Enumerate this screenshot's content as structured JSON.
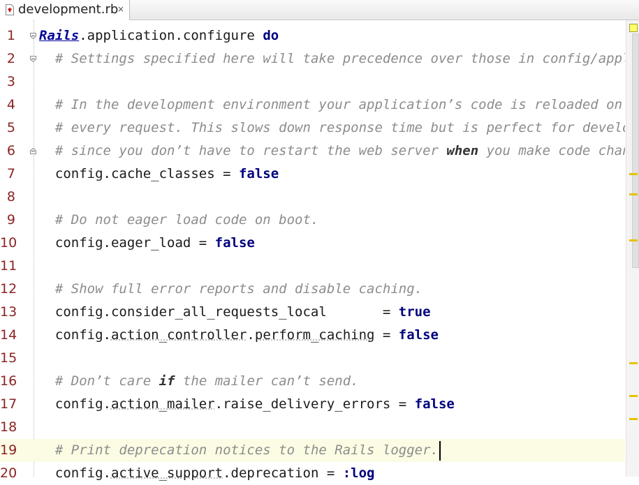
{
  "tab": {
    "title": "development.rb",
    "close_glyph": "×",
    "icon": "ruby-file-icon"
  },
  "editor": {
    "current_line": 19,
    "lines": [
      {
        "n": "1",
        "segments": [
          [
            "const",
            "Rails"
          ],
          [
            "t",
            ".application.configure "
          ],
          [
            "kw",
            "do"
          ]
        ]
      },
      {
        "n": "2",
        "segments": [
          [
            "t",
            "  "
          ],
          [
            "cmt",
            "# Settings specified here will take precedence over those in config/application.rb."
          ]
        ]
      },
      {
        "n": "3",
        "segments": []
      },
      {
        "n": "4",
        "segments": [
          [
            "t",
            "  "
          ],
          [
            "cmt",
            "# In the development environment your application’s code is reloaded on"
          ]
        ]
      },
      {
        "n": "5",
        "segments": [
          [
            "t",
            "  "
          ],
          [
            "cmt",
            "# every request. This slows down response time but is perfect for development"
          ]
        ]
      },
      {
        "n": "6",
        "segments": [
          [
            "t",
            "  "
          ],
          [
            "cmt",
            "# since you don’t have to restart the web server "
          ],
          [
            "cmtkw",
            "when"
          ],
          [
            "cmt",
            " you make code changes."
          ]
        ]
      },
      {
        "n": "7",
        "segments": [
          [
            "t",
            "  config.cache_classes = "
          ],
          [
            "kw",
            "false"
          ]
        ]
      },
      {
        "n": "8",
        "segments": []
      },
      {
        "n": "9",
        "segments": [
          [
            "t",
            "  "
          ],
          [
            "cmt",
            "# Do not eager load code on boot."
          ]
        ]
      },
      {
        "n": "10",
        "segments": [
          [
            "t",
            "  config.eager_load = "
          ],
          [
            "kw",
            "false"
          ]
        ]
      },
      {
        "n": "11",
        "segments": []
      },
      {
        "n": "12",
        "segments": [
          [
            "t",
            "  "
          ],
          [
            "cmt",
            "# Show full error reports and disable caching."
          ]
        ]
      },
      {
        "n": "13",
        "segments": [
          [
            "t",
            "  config.consider_all_requests_local       = "
          ],
          [
            "kw",
            "true"
          ]
        ]
      },
      {
        "n": "14",
        "segments": [
          [
            "t",
            "  config."
          ],
          [
            "ul",
            "action_controller"
          ],
          [
            "t",
            "."
          ],
          [
            "ul",
            "perform_caching"
          ],
          [
            "t",
            " = "
          ],
          [
            "kw",
            "false"
          ]
        ]
      },
      {
        "n": "15",
        "segments": []
      },
      {
        "n": "16",
        "segments": [
          [
            "t",
            "  "
          ],
          [
            "cmt",
            "# Don’t care "
          ],
          [
            "cmtkw",
            "if"
          ],
          [
            "cmt",
            " the mailer can’t send."
          ]
        ]
      },
      {
        "n": "17",
        "segments": [
          [
            "t",
            "  config."
          ],
          [
            "ul",
            "action_mailer"
          ],
          [
            "t",
            ".raise_delivery_errors = "
          ],
          [
            "kw",
            "false"
          ]
        ]
      },
      {
        "n": "18",
        "segments": []
      },
      {
        "n": "19",
        "segments": [
          [
            "t",
            "  "
          ],
          [
            "cmt",
            "# Print deprecation notices to the Rails logger."
          ]
        ]
      },
      {
        "n": "20",
        "segments": [
          [
            "t",
            "  config."
          ],
          [
            "ul",
            "active_support"
          ],
          [
            "t",
            ".deprecation = "
          ],
          [
            "sym",
            ":log"
          ]
        ]
      }
    ]
  },
  "colors": {
    "line_number": "#8b2323",
    "comment": "#8c8c8c",
    "keyword": "#00007f",
    "current_line_bg": "#fcfce4",
    "marker": "#e6c200"
  }
}
